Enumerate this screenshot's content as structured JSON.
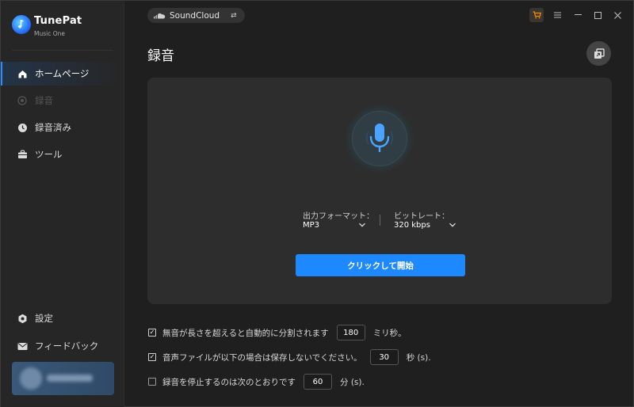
{
  "app": {
    "name": "TunePat",
    "subtitle": "Music One"
  },
  "sidebar": {
    "items": [
      {
        "label": "ホームページ",
        "icon": "home-icon"
      },
      {
        "label": "録音",
        "icon": "record-icon"
      },
      {
        "label": "録音済み",
        "icon": "clock-icon"
      },
      {
        "label": "ツール",
        "icon": "toolbox-icon"
      }
    ],
    "bottom": [
      {
        "label": "設定",
        "icon": "gear-icon"
      },
      {
        "label": "フィードバック",
        "icon": "mail-icon"
      }
    ]
  },
  "topbar": {
    "service": "SoundCloud",
    "swap_icon": "⇄"
  },
  "main": {
    "title": "録音",
    "format_label": "出力フォーマット：",
    "format_value": "MP3",
    "bitrate_label": "ビットレート：",
    "bitrate_value": "320 kbps",
    "start_button": "クリックして開始"
  },
  "options": [
    {
      "checked": true,
      "before": "無音が長さを超えると自動的に分割されます",
      "value": "180",
      "after": "ミリ秒。"
    },
    {
      "checked": true,
      "before": "音声ファイルが以下の場合は保存しないでください。",
      "value": "30",
      "after": "秒 (s)."
    },
    {
      "checked": false,
      "before": "録音を停止するのは次のとおりです",
      "value": "60",
      "after": "分 (s)."
    }
  ],
  "colors": {
    "accent": "#1e88ff",
    "active_nav_bar": "#2a8cff",
    "mic": "#4aa3ff",
    "cart": "#ff8a00"
  }
}
